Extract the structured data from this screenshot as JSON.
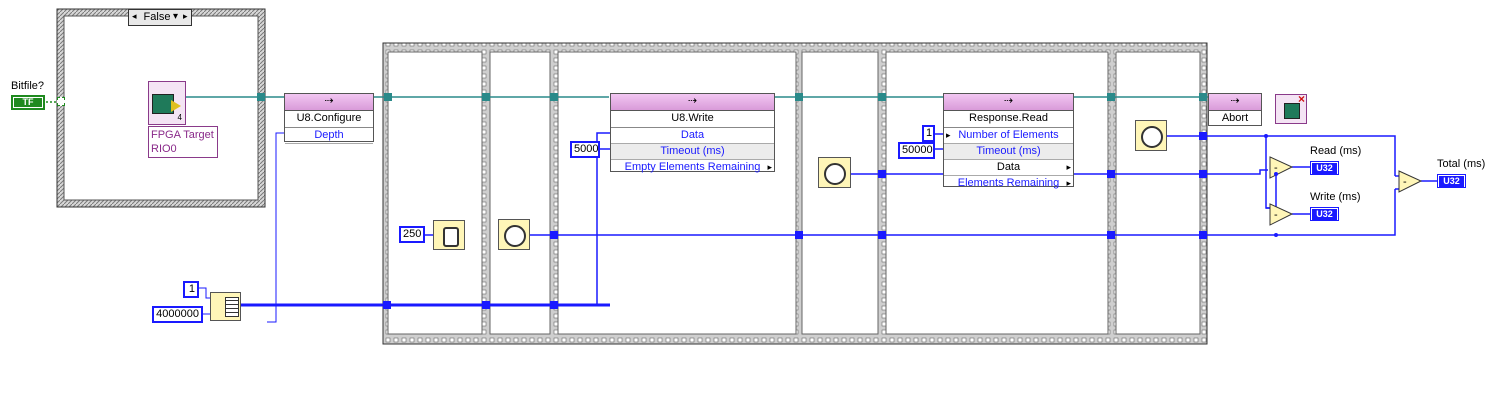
{
  "case_structure": {
    "selector": "False"
  },
  "bitfile": {
    "label": "Bitfile?",
    "indicator": "TF"
  },
  "fpga_ref": {
    "lines": [
      "FPGA Target",
      "RIO0"
    ],
    "badge": "4"
  },
  "configure_node": {
    "title": "U8.Configure",
    "terminals": [
      "Depth"
    ]
  },
  "write_node": {
    "title": "U8.Write",
    "terminals": [
      "Data",
      "Timeout (ms)",
      "Empty Elements Remaining"
    ]
  },
  "read_node": {
    "title": "Response.Read",
    "terminals": [
      "Number of Elements",
      "Timeout (ms)",
      "Data",
      "Elements Remaining"
    ]
  },
  "abort_node": {
    "title": "Abort"
  },
  "constants": {
    "array_count": "1",
    "array_size": "4000000",
    "wait_ms": "250",
    "write_timeout": "5000",
    "read_elements": "1",
    "read_timeout": "50000"
  },
  "indicators": [
    {
      "label": "Read (ms)",
      "type": "U32"
    },
    {
      "label": "Write (ms)",
      "type": "U32"
    },
    {
      "label": "Total (ms)",
      "type": "U32"
    }
  ]
}
